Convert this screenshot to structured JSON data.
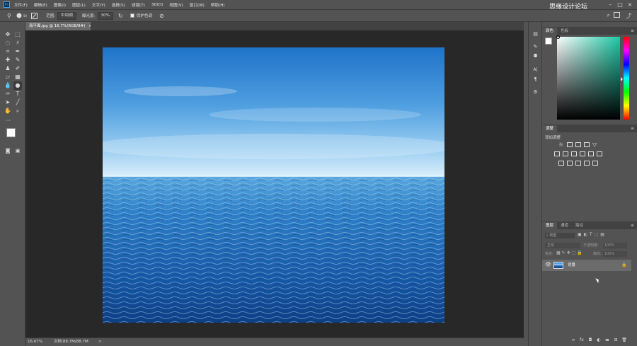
{
  "app": {
    "logo": "Ps",
    "watermark": "思缘设计论坛"
  },
  "menu": [
    "文件(F)",
    "编辑(E)",
    "图像(I)",
    "图层(L)",
    "文字(Y)",
    "选择(S)",
    "滤镜(T)",
    "3D(D)",
    "视图(V)",
    "窗口(W)",
    "帮助(H)"
  ],
  "options": {
    "range_label": "范围:",
    "range_value": "中间调",
    "exposure_label": "曝光度:",
    "exposure_value": "30%",
    "protect_label": "保护色调",
    "brush_size": "50"
  },
  "document": {
    "tab_title": "海平面.jpg @ 16.7%(RGB/8#)",
    "close_glyph": "×",
    "zoom": "16.67%",
    "doc_size": "文档:88.7M/88.7M",
    "status_arrow": ">"
  },
  "panels": {
    "color_tabs": [
      "颜色",
      "色板"
    ],
    "adjust_tab": "调整",
    "adjust_title": "添加调整",
    "layers_tabs": [
      "图层",
      "通道",
      "路径"
    ],
    "layer_filter_placeholder": "类型",
    "blend_mode": "正常",
    "opacity_label": "不透明度:",
    "opacity_value": "100%",
    "lock_label": "锁定:",
    "fill_label": "填充:",
    "fill_value": "100%",
    "layers": [
      {
        "name": "背景",
        "visible": true,
        "locked": true
      }
    ],
    "bottom_icons": [
      "link-icon",
      "fx-icon",
      "mask-icon",
      "adjustment-icon",
      "group-icon",
      "new-layer-icon",
      "trash-icon"
    ]
  },
  "icons": {
    "tools": [
      "move-icon",
      "marquee-icon",
      "lasso-icon",
      "magic-wand-icon",
      "crop-icon",
      "eyedropper-icon",
      "healing-icon",
      "brush-icon",
      "stamp-icon",
      "history-brush-icon",
      "eraser-icon",
      "gradient-icon",
      "blur-icon",
      "dodge-icon",
      "pen-icon",
      "type-icon",
      "path-select-icon",
      "line-icon",
      "hand-icon",
      "zoom-icon",
      "more-icon"
    ]
  },
  "colors": {
    "accent": "#31a8ff",
    "panel": "#535353",
    "canvas_bg": "#282828",
    "foreground": "#ffffff",
    "background": "#111111"
  }
}
